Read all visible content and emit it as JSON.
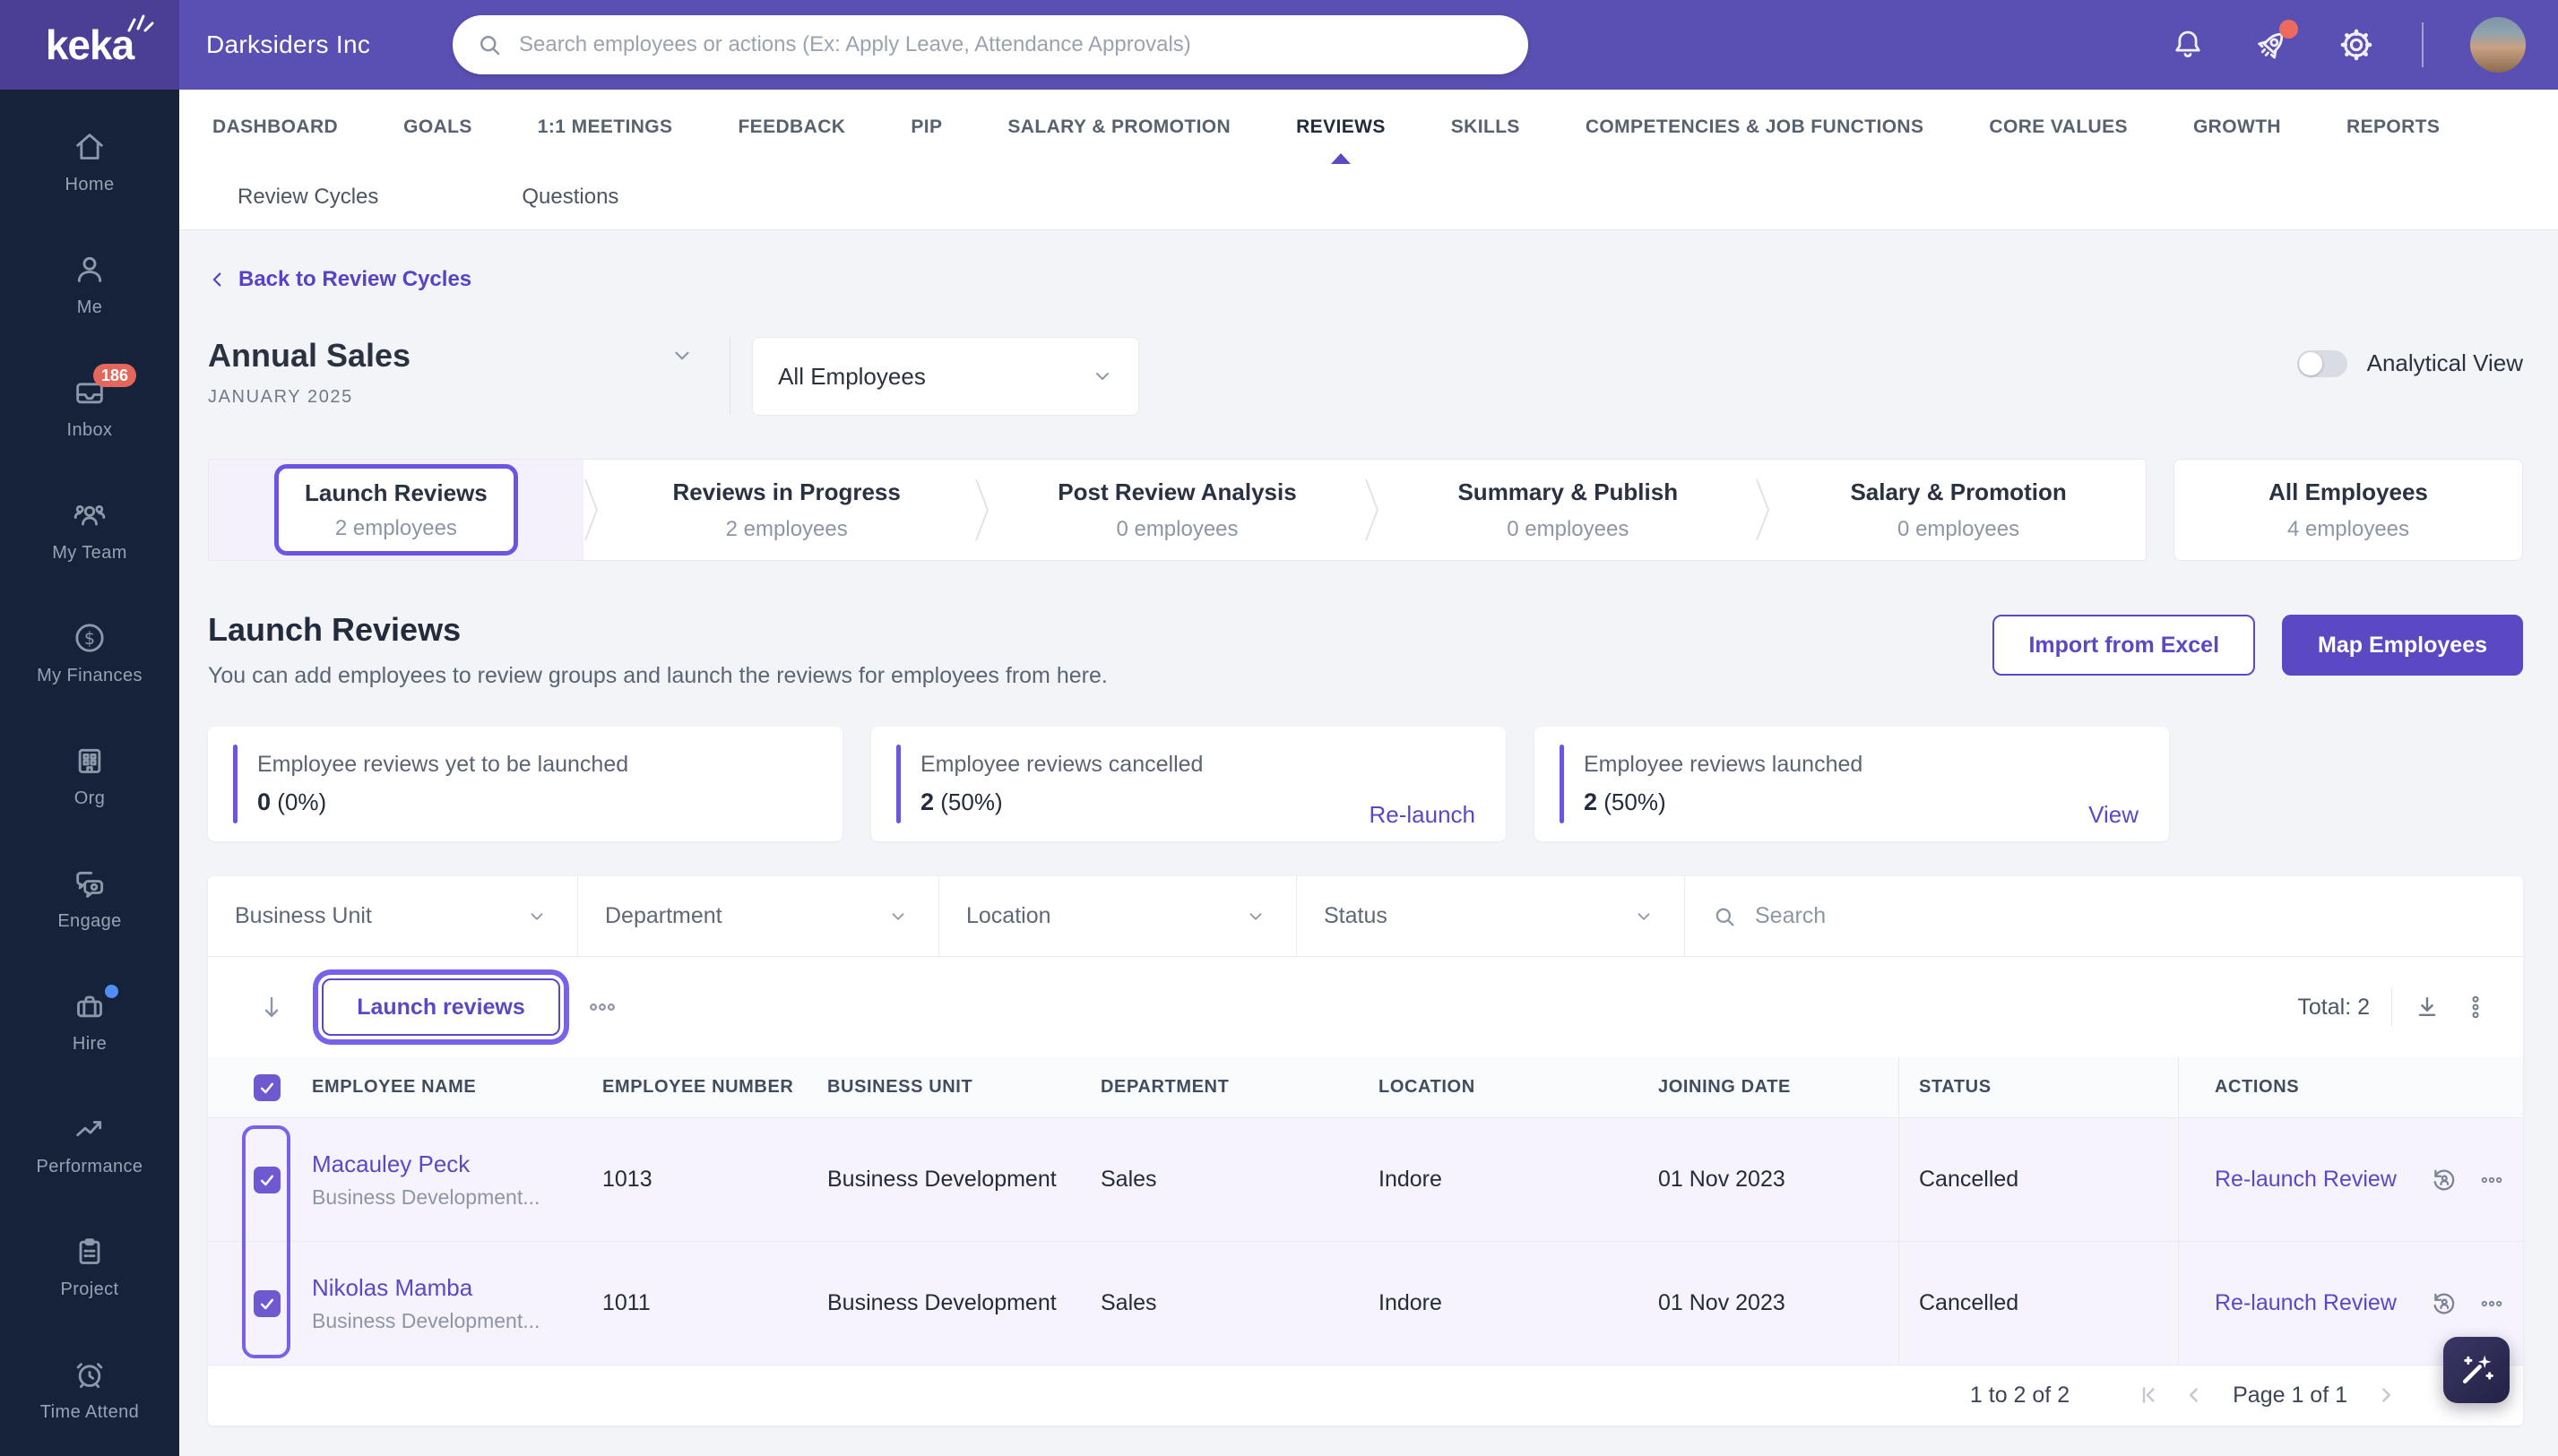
{
  "brand": {
    "logo_text": "keka",
    "company_name": "Darksiders Inc"
  },
  "topbar": {
    "search_placeholder": "Search employees or actions (Ex: Apply Leave, Attendance Approvals)"
  },
  "sidebar": {
    "items": [
      {
        "label": "Home"
      },
      {
        "label": "Me"
      },
      {
        "label": "Inbox",
        "badge": "186"
      },
      {
        "label": "My Team"
      },
      {
        "label": "My Finances"
      },
      {
        "label": "Org"
      },
      {
        "label": "Engage"
      },
      {
        "label": "Hire"
      },
      {
        "label": "Performance"
      },
      {
        "label": "Project"
      },
      {
        "label": "Time Attend"
      }
    ]
  },
  "nav": {
    "tabs": [
      "DASHBOARD",
      "GOALS",
      "1:1 MEETINGS",
      "FEEDBACK",
      "PIP",
      "SALARY & PROMOTION",
      "REVIEWS",
      "SKILLS",
      "COMPETENCIES & JOB FUNCTIONS",
      "CORE VALUES",
      "GROWTH",
      "REPORTS"
    ],
    "active_tab": "REVIEWS"
  },
  "subnav": {
    "tabs": [
      "Review Cycles",
      "Questions"
    ]
  },
  "review_cycle": {
    "back_link": "Back to Review Cycles",
    "name": "Annual Sales",
    "period": "JANUARY 2025",
    "employee_group": "All Employees",
    "analytical_view_label": "Analytical View",
    "steps": [
      {
        "label": "Launch Reviews",
        "count": "2 employees"
      },
      {
        "label": "Reviews in Progress",
        "count": "2 employees"
      },
      {
        "label": "Post Review Analysis",
        "count": "0 employees"
      },
      {
        "label": "Summary & Publish",
        "count": "0 employees"
      },
      {
        "label": "Salary & Promotion",
        "count": "0 employees"
      }
    ],
    "all_employees_card": {
      "label": "All Employees",
      "count": "4 employees"
    }
  },
  "launch_section": {
    "title": "Launch Reviews",
    "description": "You can add employees to review groups and launch the reviews for employees from here.",
    "import_button": "Import from Excel",
    "map_button": "Map Employees",
    "stats": [
      {
        "label": "Employee reviews yet to be launched",
        "value": "0",
        "percent": "(0%)"
      },
      {
        "label": "Employee reviews cancelled",
        "value": "2",
        "percent": "(50%)",
        "link": "Re-launch"
      },
      {
        "label": "Employee reviews launched",
        "value": "2",
        "percent": "(50%)",
        "link": "View"
      }
    ]
  },
  "filters": {
    "business_unit": "Business Unit",
    "department": "Department",
    "location": "Location",
    "status": "Status",
    "search_placeholder": "Search"
  },
  "toolbar": {
    "launch_button": "Launch reviews",
    "total": "Total: 2"
  },
  "table": {
    "headers": [
      "EMPLOYEE NAME",
      "EMPLOYEE NUMBER",
      "BUSINESS UNIT",
      "DEPARTMENT",
      "LOCATION",
      "JOINING DATE",
      "STATUS",
      "ACTIONS"
    ],
    "rows": [
      {
        "name": "Macauley Peck",
        "subtitle": "Business Development...",
        "number": "1013",
        "business_unit": "Business Development",
        "department": "Sales",
        "location": "Indore",
        "joining_date": "01 Nov 2023",
        "status": "Cancelled",
        "action": "Re-launch Review"
      },
      {
        "name": "Nikolas Mamba",
        "subtitle": "Business Development...",
        "number": "1011",
        "business_unit": "Business Development",
        "department": "Sales",
        "location": "Indore",
        "joining_date": "01 Nov 2023",
        "status": "Cancelled",
        "action": "Re-launch Review"
      }
    ]
  },
  "pagination": {
    "range": "1 to 2 of 2",
    "page": "Page 1 of 1"
  },
  "colors": {
    "accent": "#5b49c4",
    "focus_ring": "#7a61ea",
    "header_purple": "#5a4fb2",
    "sidebar_navy": "#15223a",
    "badge_red": "#e4675c",
    "selected_row": "#f6f3fd"
  }
}
